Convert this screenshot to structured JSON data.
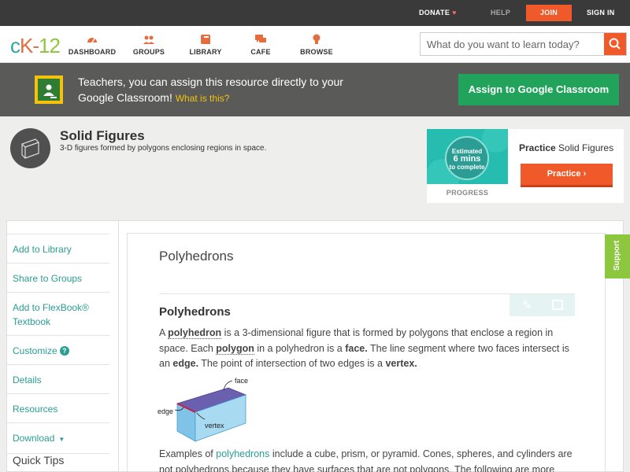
{
  "topbar": {
    "donate": "DONATE",
    "help": "HELP",
    "join": "JOIN",
    "signin": "SIGN IN"
  },
  "nav": {
    "logo": {
      "c": "c",
      "k": "K-",
      "n": "12"
    },
    "items": [
      {
        "label": "DASHBOARD",
        "icon": "dashboard-icon"
      },
      {
        "label": "GROUPS",
        "icon": "groups-icon"
      },
      {
        "label": "LIBRARY",
        "icon": "library-icon"
      },
      {
        "label": "CAFE",
        "icon": "cafe-icon"
      },
      {
        "label": "BROWSE",
        "icon": "browse-icon"
      }
    ],
    "search_placeholder": "What do you want to learn today?"
  },
  "banner": {
    "text": "Teachers, you can assign this resource directly to your Google Classroom!",
    "what": "What is this?",
    "assign_button": "Assign to Google Classroom"
  },
  "concept": {
    "title": "Solid Figures",
    "subtitle": "3-D figures formed by polygons enclosing regions in space."
  },
  "practice": {
    "est_line1": "Estimated",
    "est_line2": "6 mins",
    "est_line3": "to complete",
    "progress_label": "PROGRESS",
    "title_bold": "Practice",
    "title_rest": " Solid Figures",
    "button": "Practice"
  },
  "sidebar": {
    "items": [
      "Add to Library",
      "Share to Groups",
      "Add to FlexBook® Textbook",
      "Customize",
      "Details",
      "Resources",
      "Download"
    ],
    "quick_tips": "Quick Tips"
  },
  "article": {
    "title": "Polyhedrons",
    "section_title": "Polyhedrons",
    "p1": {
      "a": "A ",
      "polyhedron": "polyhedron",
      "b": " is a 3-dimensional figure that is formed by polygons that enclose a region in space. Each ",
      "polygon": "polygon",
      "c": " in a polyhedron is a ",
      "face": "face.",
      "d": " The line segment where two faces intersect is an ",
      "edge": "edge.",
      "e": " The point of intersection of two edges is a ",
      "vertex": "vertex."
    },
    "figure_labels": {
      "face": "face",
      "edge": "edge",
      "vertex": "vertex"
    },
    "p2": {
      "a": "Examples of ",
      "link": "polyhedrons",
      "b": " include a cube, prism, or pyramid. Cones, spheres, and cylinders are not polyhedrons because they have surfaces that are not polygons. The following are more"
    }
  },
  "support": "Support",
  "colors": {
    "accent_orange": "#f0592a",
    "teal": "#2a9d93",
    "green": "#21a35c",
    "support_green": "#8dc63f"
  }
}
